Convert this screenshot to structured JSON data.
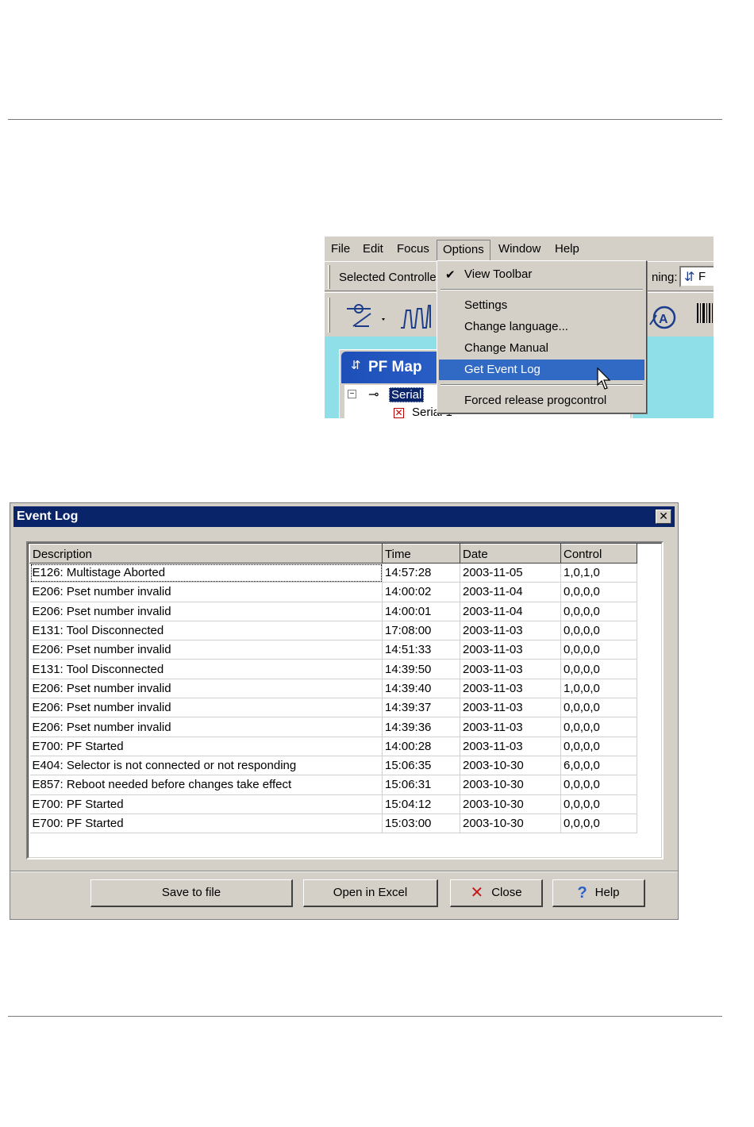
{
  "menu_screenshot": {
    "menubar": [
      "File",
      "Edit",
      "Focus",
      "Options",
      "Window",
      "Help"
    ],
    "open_menu": "Options",
    "toolbar": {
      "selected_controller_label": "Selected Controlle",
      "running_label": "ning:",
      "running_value": "F"
    },
    "pf_map": {
      "title": "PF Map",
      "tree_node_1": "Serial",
      "tree_node_2": "Serial 1"
    },
    "options_menu": {
      "view_toolbar": "View Toolbar",
      "view_toolbar_checked": true,
      "settings": "Settings",
      "change_language": "Change language...",
      "change_manual": "Change Manual",
      "get_event_log": "Get Event Log",
      "highlighted": "Get Event Log",
      "forced_release": "Forced release progcontrol"
    }
  },
  "event_log": {
    "title": "Event Log",
    "columns": [
      "Description",
      "Time",
      "Date",
      "Control"
    ],
    "rows": [
      [
        "E126: Multistage Aborted",
        "14:57:28",
        "2003-11-05",
        "1,0,1,0"
      ],
      [
        "E206: Pset number invalid",
        "14:00:02",
        "2003-11-04",
        "0,0,0,0"
      ],
      [
        "E206: Pset number invalid",
        "14:00:01",
        "2003-11-04",
        "0,0,0,0"
      ],
      [
        "E131: Tool Disconnected",
        "17:08:00",
        "2003-11-03",
        "0,0,0,0"
      ],
      [
        "E206: Pset number invalid",
        "14:51:33",
        "2003-11-03",
        "0,0,0,0"
      ],
      [
        "E131: Tool Disconnected",
        "14:39:50",
        "2003-11-03",
        "0,0,0,0"
      ],
      [
        "E206: Pset number invalid",
        "14:39:40",
        "2003-11-03",
        "1,0,0,0"
      ],
      [
        "E206: Pset number invalid",
        "14:39:37",
        "2003-11-03",
        "0,0,0,0"
      ],
      [
        "E206: Pset number invalid",
        "14:39:36",
        "2003-11-03",
        "0,0,0,0"
      ],
      [
        "E700: PF Started",
        "14:00:28",
        "2003-11-03",
        "0,0,0,0"
      ],
      [
        "E404: Selector is not connected or not responding",
        "15:06:35",
        "2003-10-30",
        "6,0,0,0"
      ],
      [
        "E857: Reboot needed before changes take effect",
        "15:06:31",
        "2003-10-30",
        "0,0,0,0"
      ],
      [
        "E700: PF Started",
        "15:04:12",
        "2003-10-30",
        "0,0,0,0"
      ],
      [
        "E700: PF Started",
        "15:03:00",
        "2003-10-30",
        "0,0,0,0"
      ]
    ],
    "buttons": {
      "save": "Save to file",
      "excel": "Open in Excel",
      "close": "Close",
      "help": "Help"
    },
    "close_icon": "close-x-icon",
    "help_icon": "question-mark-icon"
  }
}
